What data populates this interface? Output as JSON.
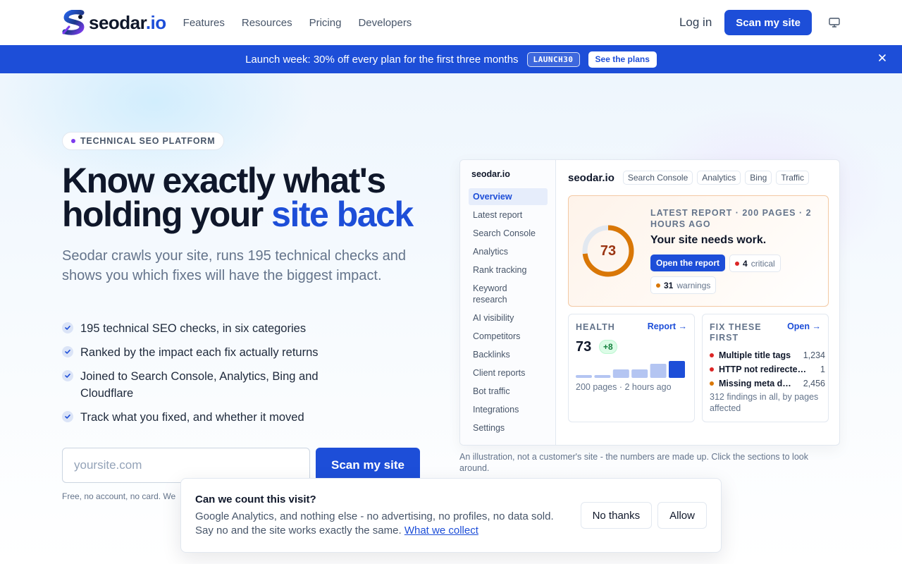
{
  "nav": {
    "logo_name": "seodar",
    "logo_tld": ".io",
    "links": [
      "Features",
      "Resources",
      "Pricing",
      "Developers"
    ],
    "login": "Log in",
    "cta": "Scan my site"
  },
  "banner": {
    "text": "Launch week: 30% off every plan for the first three months",
    "code": "LAUNCH30",
    "button": "See the plans"
  },
  "hero": {
    "pill": "TECHNICAL SEO PLATFORM",
    "headline_line1": "Know exactly what's",
    "headline_line2_plain": "holding your ",
    "headline_line2_accent": "site back",
    "subhead": "Seodar crawls your site, runs 195 technical checks and shows you which fixes will have the biggest impact.",
    "features": [
      "195 technical SEO checks, in six categories",
      "Ranked by the impact each fix actually returns",
      "Joined to Search Console, Analytics, Bing and Cloudflare",
      "Track what you fixed, and whether it moved"
    ],
    "input_placeholder": "yoursite.com",
    "scan_button": "Scan my site",
    "fine_print": "Free, no account, no card. We"
  },
  "dashboard": {
    "brand": "seodar.io",
    "nav": [
      "Overview",
      "Latest report",
      "Search Console",
      "Analytics",
      "Rank tracking",
      "Keyword research",
      "AI visibility",
      "Competitors",
      "Backlinks",
      "Client reports",
      "Bot traffic",
      "Integrations",
      "Settings"
    ],
    "active_nav": 0,
    "site": "seodar.io",
    "integrations": [
      "Search Console",
      "Analytics",
      "Bing",
      "Traffic"
    ],
    "report": {
      "score": "73",
      "score_value": 73,
      "meta": "LATEST REPORT · 200 PAGES · 2 HOURS AGO",
      "title": "Your site needs work.",
      "open_button": "Open the report",
      "critical_count": "4",
      "critical_label": "critical",
      "warning_count": "31",
      "warning_label": "warnings"
    },
    "health": {
      "label": "HEALTH",
      "link": "Report",
      "score": "73",
      "delta": "+8",
      "trend": [
        2,
        2,
        6,
        6,
        10,
        12
      ],
      "footer": "200 pages · 2 hours ago"
    },
    "fixes": {
      "label": "FIX THESE FIRST",
      "link": "Open",
      "items": [
        {
          "name": "Multiple title tags",
          "count": "1,234",
          "severity": "critical"
        },
        {
          "name": "HTTP not redirecte…",
          "count": "1",
          "severity": "critical"
        },
        {
          "name": "Missing meta d…",
          "count": "2,456",
          "severity": "warning"
        }
      ],
      "footer": "312 findings in all, by pages affected"
    },
    "caption": "An illustration, not a customer's site - the numbers are made up. Click the sections to look around."
  },
  "cookie": {
    "title": "Can we count this visit?",
    "body": "Google Analytics, and nothing else - no advertising, no profiles, no data sold. Say no and the site works exactly the same. ",
    "link": "What we collect",
    "decline": "No thanks",
    "accept": "Allow"
  },
  "colors": {
    "brand_blue": "#1d4ed8",
    "critical": "#dc2626",
    "warning": "#d97706",
    "gauge": "#d97706"
  },
  "icons": [
    "monitor-icon",
    "close-icon",
    "check-icon",
    "arrow-right-icon"
  ]
}
